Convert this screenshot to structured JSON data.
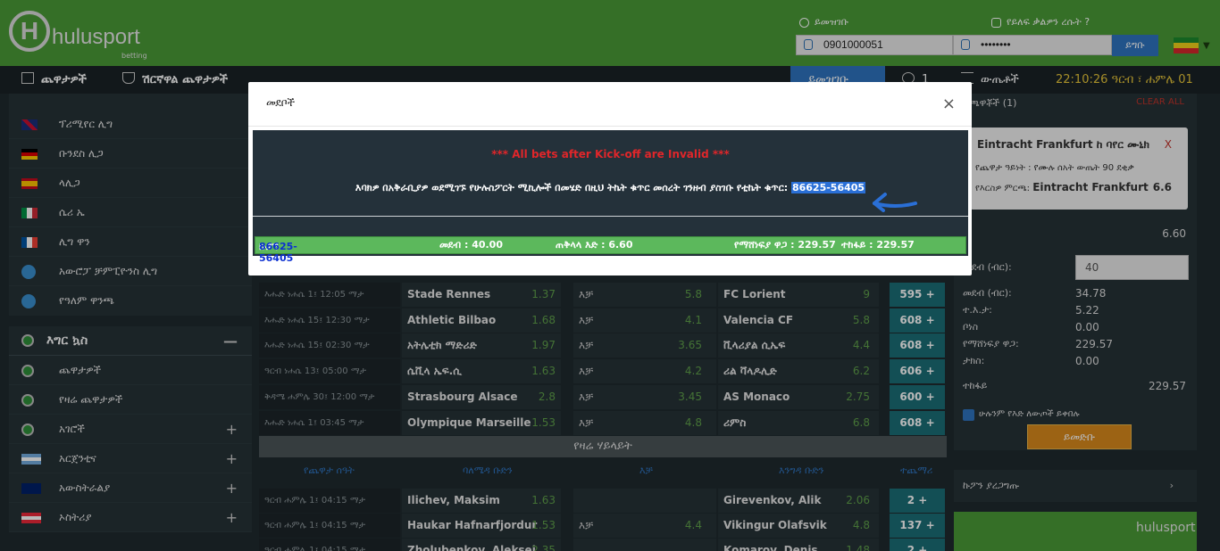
{
  "header": {
    "logo_letter": "H",
    "logo_text": "hulusport",
    "logo_sub": "betting",
    "register_label": "ይመዝገቡ",
    "forgot_label": "የይለፍ ቃልዎን ረሱት ?",
    "phone_value": "0901000051",
    "password_value": "••••••••",
    "login_label": "ይግቡ"
  },
  "nav": {
    "games": "ጨዋታዎች",
    "live": "ሽርኛዋል ጨዋታዎች",
    "register": "ይመዝገቡ",
    "count": "1",
    "results": "ውጤቶች",
    "clock": "22:10:26 ዓርብ ፣ ሐምሌ 01 2014"
  },
  "sidebar": {
    "leagues": [
      {
        "label": "ፕሪሚየር ሊግ",
        "flag": "gb"
      },
      {
        "label": "ቡንደስ ሊጋ",
        "flag": "de"
      },
      {
        "label": "ላሊጋ",
        "flag": "es"
      },
      {
        "label": "ሴሪ ኤ",
        "flag": "it"
      },
      {
        "label": "ሊግ ዋን",
        "flag": "fr"
      },
      {
        "label": "አውሮፓ ቻምፒዮንስ ሊግ",
        "flag": "world"
      },
      {
        "label": "የዓለም ዋንጫ",
        "flag": "world"
      }
    ],
    "section_title": "እግር ኳስ",
    "section_toggle": "—",
    "items": [
      {
        "label": "ጨዋታዎች"
      },
      {
        "label": "የዛሬ ጨዋታዎች"
      },
      {
        "label": "አገሮች",
        "plus": "+"
      },
      {
        "label": "አርጀንቲና",
        "plus": "+"
      },
      {
        "label": "አውስትራልያ",
        "plus": "+"
      },
      {
        "label": "ኦስትሪያ",
        "plus": "+"
      }
    ]
  },
  "matches": [
    {
      "time": "እሑድ ነሐሴ 1፤ 12:05 ማታ",
      "home": "Stade Rennes",
      "o1": "1.37",
      "draw": "እቻ",
      "ox": "5.8",
      "away": "FC Lorient",
      "o2": "9",
      "more": "595 +"
    },
    {
      "time": "እሑድ ነሐሴ 15፤ 12:30 ማታ",
      "home": "Athletic Bilbao",
      "o1": "1.68",
      "draw": "እቻ",
      "ox": "4.1",
      "away": "Valencia CF",
      "o2": "5.8",
      "more": "608 +"
    },
    {
      "time": "እሑድ ነሐሴ 15፤ 02:30 ማታ",
      "home": "አትሌቲክ ማድሪድ",
      "o1": "1.97",
      "draw": "እቻ",
      "ox": "3.65",
      "away": "ቪላሪያል ሲኤፍ",
      "o2": "4.4",
      "more": "608 +"
    },
    {
      "time": "ዓርብ ነሐሴ 13፤ 05:00 ማታ",
      "home": "ሴቪላ ኤፍ.ሲ",
      "o1": "1.63",
      "draw": "እቻ",
      "ox": "4.2",
      "away": "ሪል ቫላዶሊድ",
      "o2": "6.2",
      "more": "606 +"
    },
    {
      "time": "ቅዳሜ ሐምሌ 30፤ 12:00 ማታ",
      "home": "Strasbourg Alsace",
      "o1": "2.8",
      "draw": "እቻ",
      "ox": "3.45",
      "away": "AS Monaco",
      "o2": "2.75",
      "more": "600 +"
    },
    {
      "time": "እሑድ ነሐሴ 1፤ 03:45 ማታ",
      "home": "Olympique Marseille",
      "o1": "1.53",
      "draw": "እቻ",
      "ox": "4.8",
      "away": "ሪምስ",
      "o2": "6.8",
      "more": "608 +"
    }
  ],
  "highlights": {
    "title": "የዛሬ ሃይላይት",
    "col_time": "የጨዋታ ሰዓት",
    "col_home": "ባለሜዳ ቡድን",
    "col_draw": "እቻ",
    "col_away": "እንግዳ ቡድን",
    "col_more": "ተጨማሪ",
    "rows": [
      {
        "time": "ዓርብ ሐምሌ 1፤ 04:15 ማታ",
        "home": "Ilichev, Maksim",
        "o1": "1.63",
        "draw": "",
        "ox": "",
        "away": "Girevenkov, Alik",
        "o2": "2.06",
        "more": "2 +"
      },
      {
        "time": "ዓርብ ሐምሌ 1፤ 04:15 ማታ",
        "home": "Haukar Hafnarfjordur",
        "o1": "1.53",
        "draw": "እቻ",
        "ox": "4.4",
        "away": "Vikingur Olafsvik",
        "o2": "4.8",
        "more": "137 +"
      },
      {
        "time": "ዓርብ ሐምሌ 1፤ 04:15 ማታ",
        "home": "Zholubenkov, Aleksei",
        "o1": "2.35",
        "draw": "",
        "ox": "",
        "away": "Komarov, Denis",
        "o2": "1.48",
        "more": "2 +"
      }
    ]
  },
  "betslip": {
    "title": "ተጫዋቾች (1)",
    "clear": "CLEAR ALL",
    "match": "Eintracht Frankfurt ከ ባየር ሙኒክ",
    "remove": "X",
    "market": "የጨዋታ ዓይነት : የሙሉ ሰአት ውጤት 90 ደቂቃ",
    "pick_label": "የእርስዎ ምርጫ:",
    "pick_value": "Eintracht Frankfurt",
    "pick_odd": "6.6",
    "total_odds": "6.60",
    "stake_label": "መደብ (ብር):",
    "stake_value": "40",
    "rows": [
      {
        "label": "መደብ (ብር):",
        "value": "34.78"
      },
      {
        "label": "ተ.እ.ታ:",
        "value": "5.22"
      },
      {
        "label": "ቦነስ",
        "value": "0.00"
      },
      {
        "label": "የማሸነፍያ ዋጋ:",
        "value": "229.57"
      },
      {
        "label": "ታክስ:",
        "value": "0.00"
      }
    ],
    "payout_label": "ተከፋይ",
    "payout_value": "229.57",
    "accept_label": "ሁሉንም የእድ ለውጦች ይቀበሉ",
    "place_label": "ይመድቡ"
  },
  "coupon_check": {
    "label": "ኩፖን ያረጋግጡ",
    "chevron": "›"
  },
  "promo": {
    "logo_text": "hulusport"
  },
  "modal": {
    "title": "መደቦች",
    "close": "×",
    "warning": "*** All bets after Kick-off are Invalid ***",
    "message": "እባክዎ በአቅራቢያዎ ወደሚገኙ የሁሉስፖርት ሚኪሎች በመሄድ በዚህ ትኬት ቁጥር መሰረት ገንዘብ ያስገቡ የቲኬት ቁጥር:",
    "ticket_code": "86625-56405",
    "summary": {
      "coupon_label": "ኩፖን ቁጥር :",
      "coupon_value": "86625-56405",
      "stake": "መደብ : 40.00",
      "total_odds": "ጠቅላላ እድ : 6.60",
      "win": "የማሸነፍያ ዋጋ : 229.57",
      "payout": "ተከፋይ : 229.57"
    }
  }
}
